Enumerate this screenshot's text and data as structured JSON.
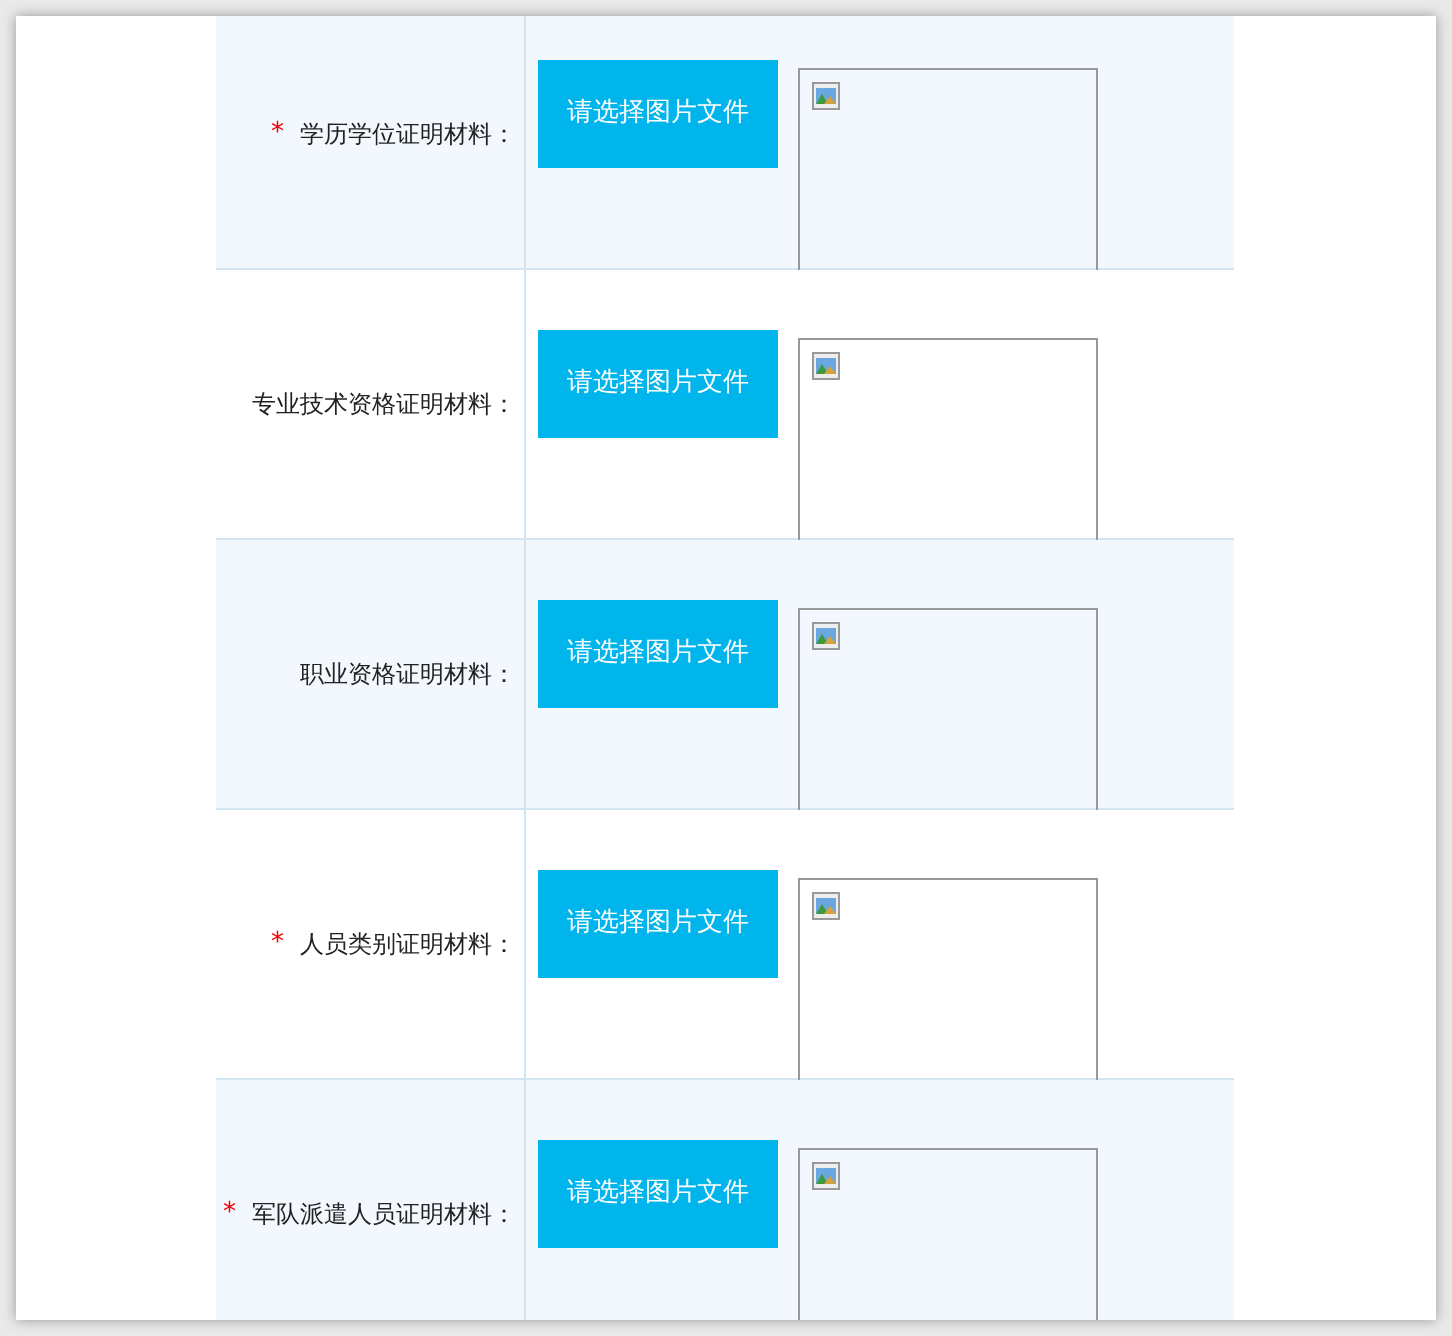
{
  "rows": [
    {
      "label": "学历学位证明材料：",
      "required_mark": "*",
      "button": "请选择图片文件"
    },
    {
      "label": "专业技术资格证明材料：",
      "button": "请选择图片文件"
    },
    {
      "label": "职业资格证明材料：",
      "button": "请选择图片文件"
    },
    {
      "label": "人员类别证明材料：",
      "required_mark": "*",
      "button": "请选择图片文件"
    },
    {
      "label": "军队派遣人员证明材料：",
      "required_mark": "*",
      "button": "请选择图片文件"
    }
  ]
}
